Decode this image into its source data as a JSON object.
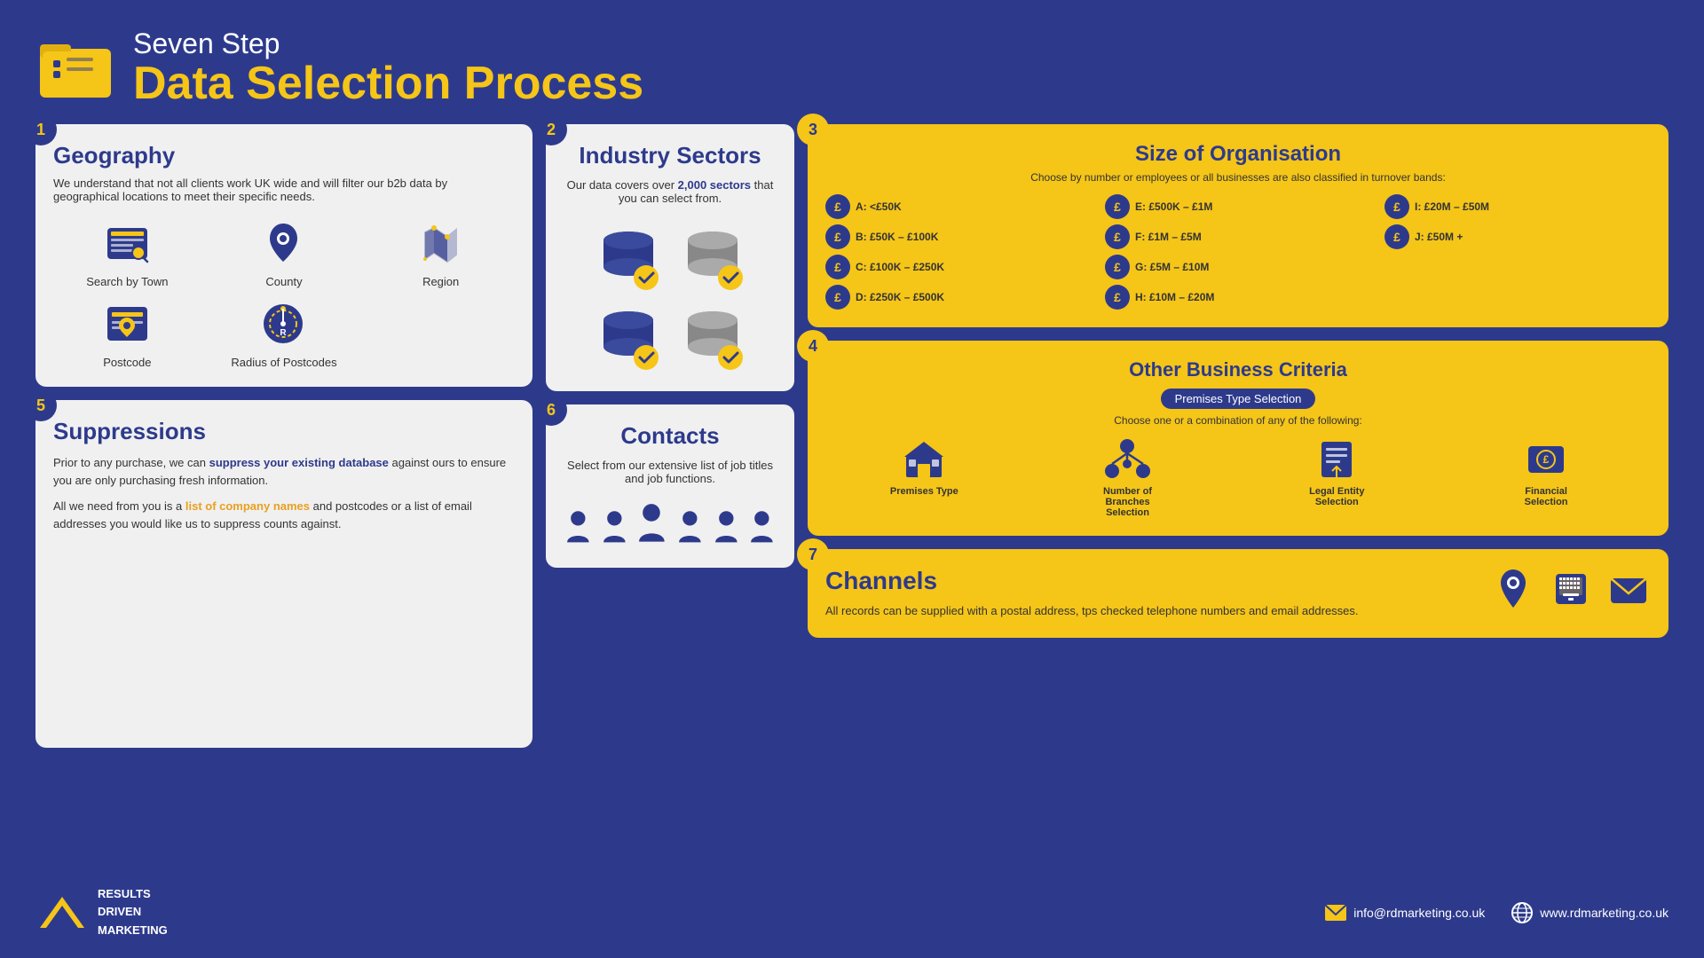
{
  "header": {
    "subtitle": "Seven Step",
    "title": "Data Selection Process"
  },
  "steps": {
    "step1": {
      "number": "1",
      "title": "Geography",
      "description": "We understand that not all clients work UK wide and will filter our b2b data by geographical locations to meet their specific needs.",
      "icons": [
        {
          "name": "search-by-town",
          "label": "Search by Town"
        },
        {
          "name": "county",
          "label": "County"
        },
        {
          "name": "region",
          "label": "Region"
        },
        {
          "name": "postcode",
          "label": "Postcode"
        },
        {
          "name": "radius-of-postcodes",
          "label": "Radius of Postcodes"
        }
      ]
    },
    "step2": {
      "number": "2",
      "title": "Industry Sectors",
      "description": "Our data covers over ",
      "highlight": "2,000 sectors",
      "description2": " that you can select from."
    },
    "step3": {
      "number": "3",
      "title": "Size of Organisation",
      "subtitle": "Choose by number or employees or all businesses are also classified in turnover bands:",
      "bands": [
        {
          "label": "A: <£50K"
        },
        {
          "label": "E: £500K – £1M"
        },
        {
          "label": "I: £20M – £50M"
        },
        {
          "label": "B: £50K – £100K"
        },
        {
          "label": "F: £1M – £5M"
        },
        {
          "label": "J: £50M +"
        },
        {
          "label": "C: £100K – £250K"
        },
        {
          "label": "G: £5M – £10M"
        },
        {
          "label": ""
        },
        {
          "label": "D: £250K – £500K"
        },
        {
          "label": "H: £10M – £20M"
        },
        {
          "label": ""
        }
      ]
    },
    "step4": {
      "number": "4",
      "title": "Other Business Criteria",
      "badge": "Premises Type Selection",
      "subtitle": "Choose one or a combination of any of the following:",
      "items": [
        {
          "name": "premises-type",
          "label": "Premises Type"
        },
        {
          "name": "number-of-branches-selection",
          "label": "Number of Branches Selection"
        },
        {
          "name": "legal-entity-selection",
          "label": "Legal Entity Selection"
        },
        {
          "name": "financial-selection",
          "label": "Financial Selection"
        }
      ]
    },
    "step5": {
      "number": "5",
      "title": "Suppressions",
      "para1_before": "Prior to any purchase, we can ",
      "para1_highlight": "suppress your existing database",
      "para1_after": " against ours to ensure you are only purchasing fresh information.",
      "para2_before": "All we need from you is a ",
      "para2_highlight": "list of company names",
      "para2_after": " and postcodes or a list of email addresses you would like us to suppress counts against."
    },
    "step6": {
      "number": "6",
      "title": "Contacts",
      "description": "Select from our extensive list of job titles and job functions."
    },
    "step7": {
      "number": "7",
      "title": "Channels",
      "description": "All records can be supplied with a postal address, tps checked telephone numbers and email addresses."
    }
  },
  "footer": {
    "logo_lines": [
      "RESULTS",
      "DRIVEN",
      "MARKETING"
    ],
    "email": "info@rdmarketing.co.uk",
    "website": "www.rdmarketing.co.uk"
  }
}
